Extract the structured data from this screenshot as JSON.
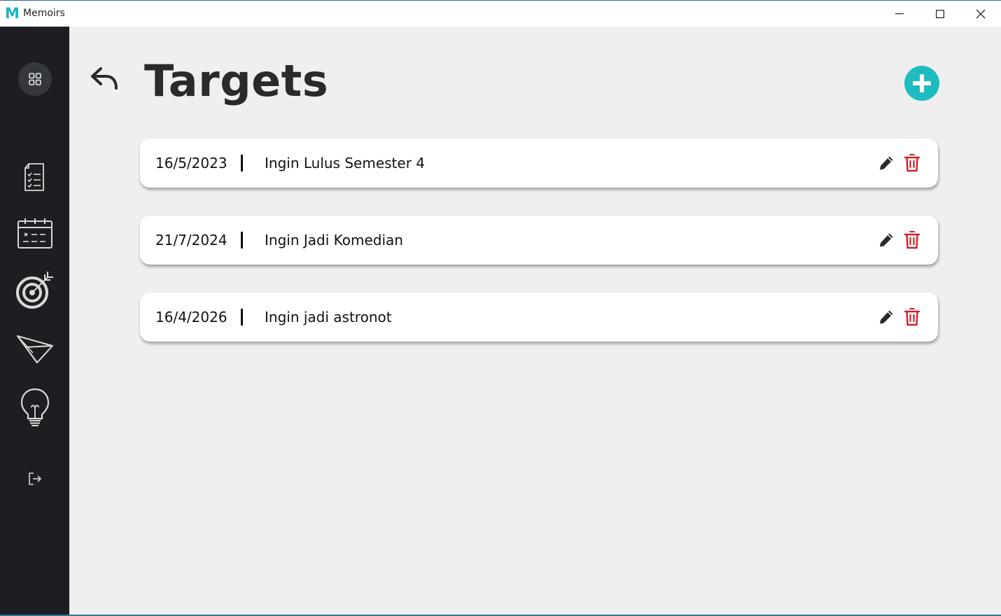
{
  "window": {
    "title": "Memoirs",
    "logo_letter": "M",
    "controls": [
      "minimize-icon",
      "maximize-icon",
      "close-icon"
    ]
  },
  "sidebar": {
    "items": [
      {
        "name": "dashboard",
        "icon": "grid-icon"
      },
      {
        "name": "notes",
        "icon": "checklist-icon"
      },
      {
        "name": "calendar",
        "icon": "calendar-icon"
      },
      {
        "name": "targets",
        "icon": "target-icon"
      },
      {
        "name": "send",
        "icon": "paper-plane-icon"
      },
      {
        "name": "ideas",
        "icon": "lightbulb-icon"
      },
      {
        "name": "logout",
        "icon": "logout-icon"
      }
    ]
  },
  "header": {
    "title": "Targets",
    "back_icon": "back-arrow-icon",
    "add_icon": "plus-icon"
  },
  "targets": [
    {
      "date": "16/5/2023",
      "text": "Ingin Lulus Semester 4"
    },
    {
      "date": "21/7/2024",
      "text": "Ingin Jadi Komedian"
    },
    {
      "date": "16/4/2026",
      "text": "Ingin jadi astronot"
    }
  ],
  "colors": {
    "sidebar_bg": "#1c1e22",
    "accent": "#1fbcbf",
    "delete": "#d0202a",
    "page_bg": "#efefef"
  }
}
